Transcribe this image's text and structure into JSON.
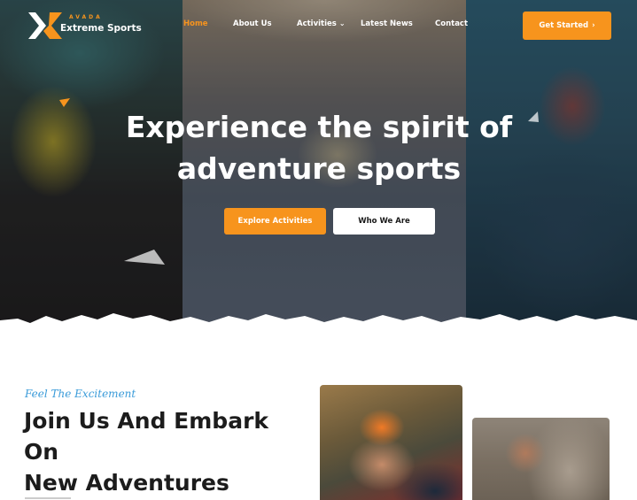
{
  "header": {
    "logo_top": "AVADA",
    "logo_name": "Extreme Sports",
    "nav": [
      {
        "label": "Home",
        "active": true
      },
      {
        "label": "About Us",
        "active": false
      },
      {
        "label": "Activities",
        "active": false,
        "dropdown": true
      },
      {
        "label": "Latest News",
        "active": false
      },
      {
        "label": "Contact",
        "active": false
      }
    ],
    "cta_label": "Get Started",
    "cta_icon": "chevron-right-icon"
  },
  "hero": {
    "title_line1": "Experience the spirit of",
    "title_line2": "adventure sports",
    "primary_button": "Explore Activities",
    "secondary_button": "Who We Are"
  },
  "section": {
    "tagline": "Feel The Excitement",
    "title_line1": "Join Us And Embark On",
    "title_line2": "New Adventures"
  },
  "colors": {
    "accent": "#f7941d",
    "tagline": "#3a9bd9",
    "heading": "#1c1c1c",
    "white": "#ffffff"
  }
}
